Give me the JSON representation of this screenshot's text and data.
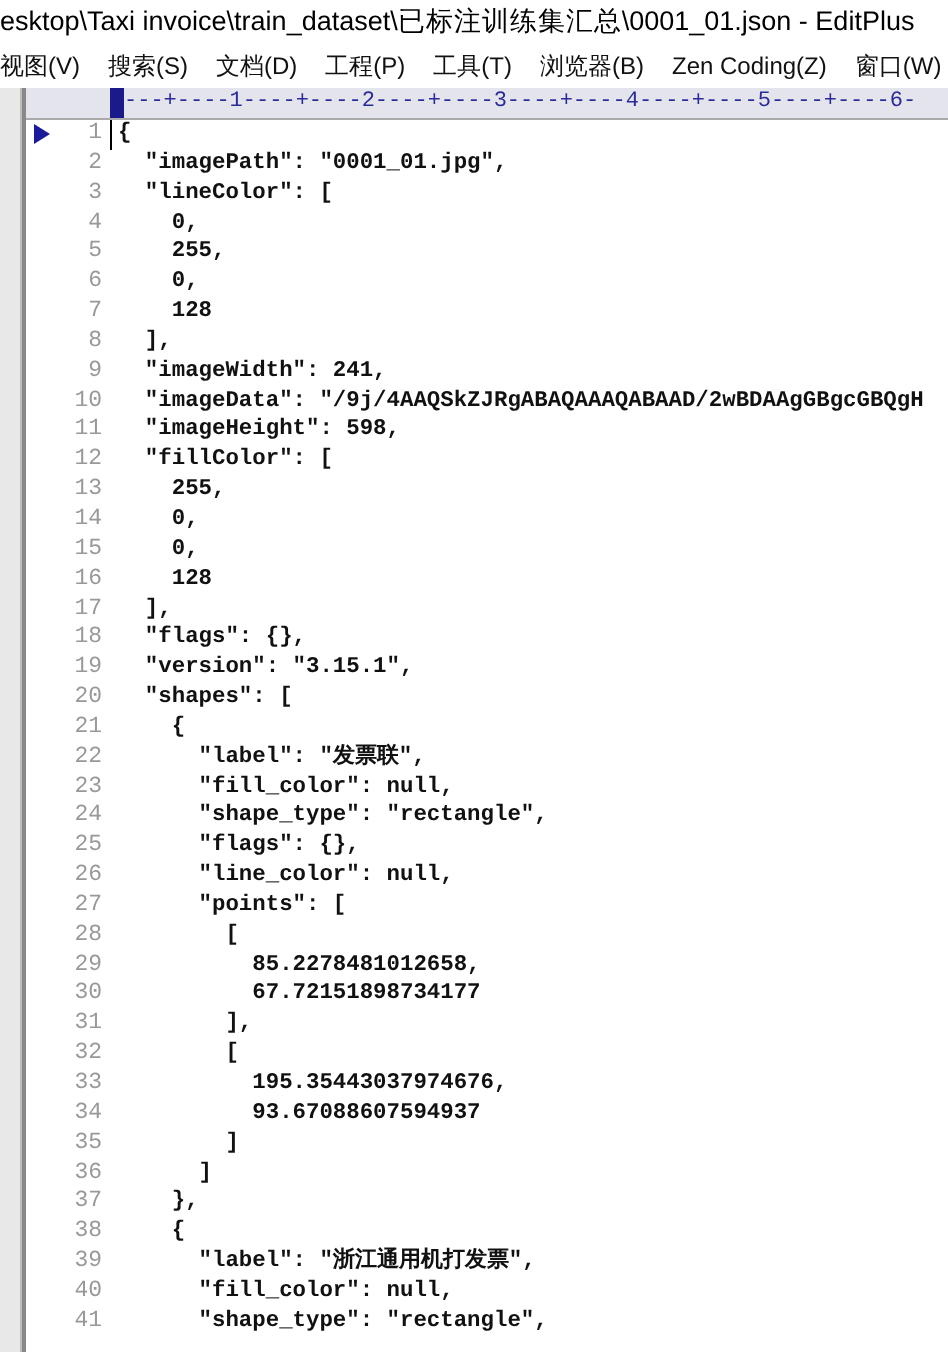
{
  "window": {
    "title": "esktop\\Taxi invoice\\train_dataset\\已标注训练集汇总\\0001_01.json - EditPlus"
  },
  "menu": [
    "视图(V)",
    "搜索(S)",
    "文档(D)",
    "工程(P)",
    "工具(T)",
    "浏览器(B)",
    "Zen Coding(Z)",
    "窗口(W)"
  ],
  "ruler": "---+----1----+----2----+----3----+----4----+----5----+----6-",
  "editor": {
    "lines": [
      {
        "number": "1",
        "text": "{",
        "current": true
      },
      {
        "number": "2",
        "text": "  \"imagePath\": \"0001_01.jpg\",",
        "current": false
      },
      {
        "number": "3",
        "text": "  \"lineColor\": [",
        "current": false
      },
      {
        "number": "4",
        "text": "    0,",
        "current": false
      },
      {
        "number": "5",
        "text": "    255,",
        "current": false
      },
      {
        "number": "6",
        "text": "    0,",
        "current": false
      },
      {
        "number": "7",
        "text": "    128",
        "current": false
      },
      {
        "number": "8",
        "text": "  ],",
        "current": false
      },
      {
        "number": "9",
        "text": "  \"imageWidth\": 241,",
        "current": false
      },
      {
        "number": "10",
        "text": "  \"imageData\": \"/9j/4AAQSkZJRgABAQAAAQABAAD/2wBDAAgGBgcGBQgH",
        "current": false
      },
      {
        "number": "11",
        "text": "  \"imageHeight\": 598,",
        "current": false
      },
      {
        "number": "12",
        "text": "  \"fillColor\": [",
        "current": false
      },
      {
        "number": "13",
        "text": "    255,",
        "current": false
      },
      {
        "number": "14",
        "text": "    0,",
        "current": false
      },
      {
        "number": "15",
        "text": "    0,",
        "current": false
      },
      {
        "number": "16",
        "text": "    128",
        "current": false
      },
      {
        "number": "17",
        "text": "  ],",
        "current": false
      },
      {
        "number": "18",
        "text": "  \"flags\": {},",
        "current": false
      },
      {
        "number": "19",
        "text": "  \"version\": \"3.15.1\",",
        "current": false
      },
      {
        "number": "20",
        "text": "  \"shapes\": [",
        "current": false
      },
      {
        "number": "21",
        "text": "    {",
        "current": false
      },
      {
        "number": "22",
        "text": "      \"label\": \"发票联\",",
        "current": false
      },
      {
        "number": "23",
        "text": "      \"fill_color\": null,",
        "current": false
      },
      {
        "number": "24",
        "text": "      \"shape_type\": \"rectangle\",",
        "current": false
      },
      {
        "number": "25",
        "text": "      \"flags\": {},",
        "current": false
      },
      {
        "number": "26",
        "text": "      \"line_color\": null,",
        "current": false
      },
      {
        "number": "27",
        "text": "      \"points\": [",
        "current": false
      },
      {
        "number": "28",
        "text": "        [",
        "current": false
      },
      {
        "number": "29",
        "text": "          85.2278481012658,",
        "current": false
      },
      {
        "number": "30",
        "text": "          67.72151898734177",
        "current": false
      },
      {
        "number": "31",
        "text": "        ],",
        "current": false
      },
      {
        "number": "32",
        "text": "        [",
        "current": false
      },
      {
        "number": "33",
        "text": "          195.35443037974676,",
        "current": false
      },
      {
        "number": "34",
        "text": "          93.67088607594937",
        "current": false
      },
      {
        "number": "35",
        "text": "        ]",
        "current": false
      },
      {
        "number": "36",
        "text": "      ]",
        "current": false
      },
      {
        "number": "37",
        "text": "    },",
        "current": false
      },
      {
        "number": "38",
        "text": "    {",
        "current": false
      },
      {
        "number": "39",
        "text": "      \"label\": \"浙江通用机打发票\",",
        "current": false
      },
      {
        "number": "40",
        "text": "      \"fill_color\": null,",
        "current": false
      },
      {
        "number": "41",
        "text": "      \"shape_type\": \"rectangle\",",
        "current": false
      }
    ]
  }
}
